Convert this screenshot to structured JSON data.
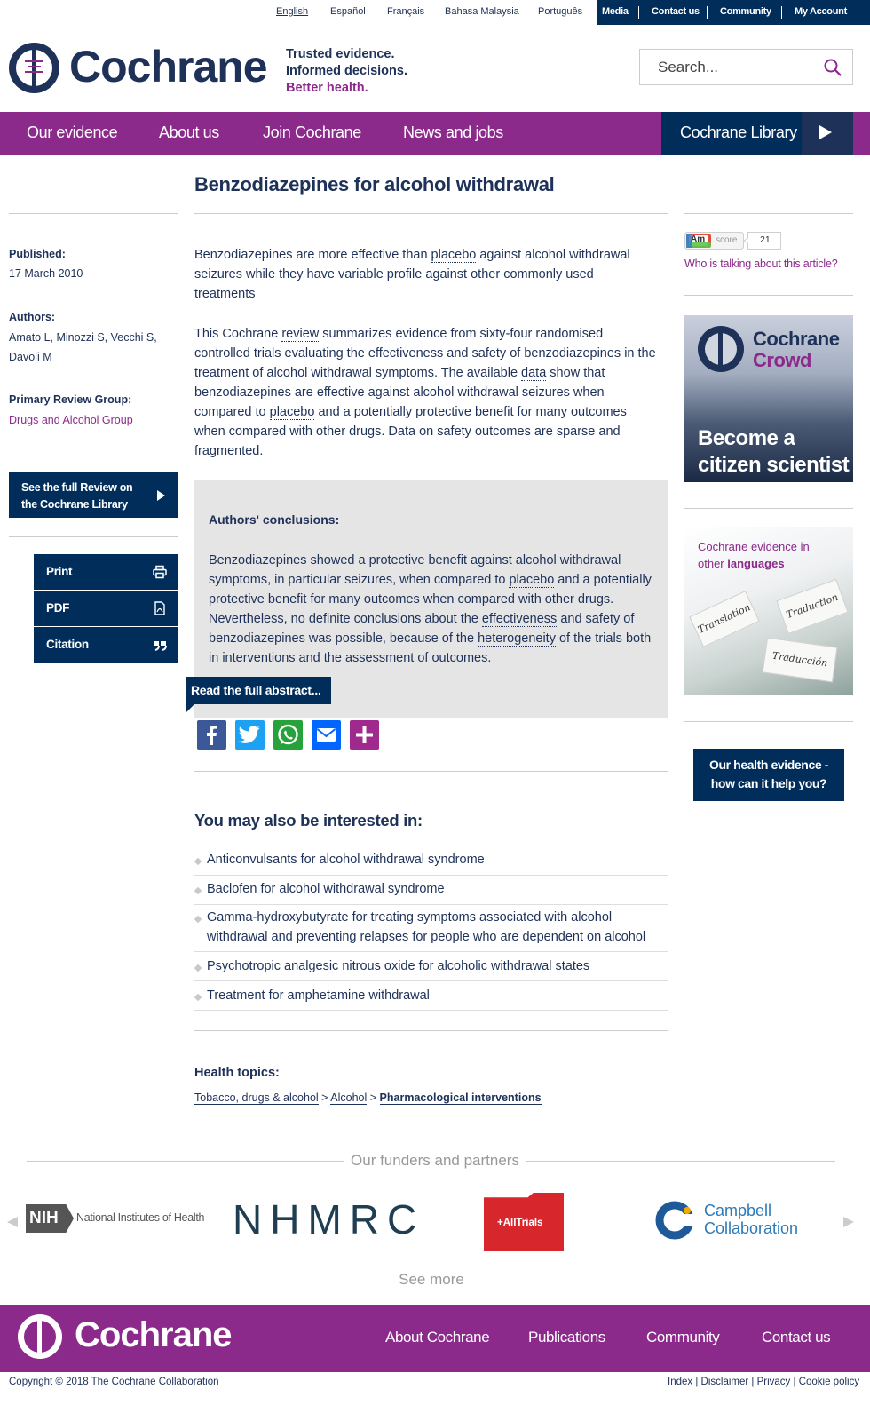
{
  "top_links": {
    "languages": [
      "English",
      "Español",
      "Français",
      "Bahasa Malaysia",
      "Português"
    ],
    "utility": [
      "Media",
      "Contact us",
      "Community",
      "My Account"
    ]
  },
  "header": {
    "wordmark": "Cochrane",
    "tagline": [
      "Trusted evidence.",
      "Informed decisions.",
      "Better health."
    ],
    "search_placeholder": "Search..."
  },
  "nav": {
    "items": [
      "Our evidence",
      "About us",
      "Join Cochrane",
      "News and jobs"
    ],
    "library": "Cochrane Library"
  },
  "article": {
    "title": "Benzodiazepines for alcohol withdrawal",
    "published_label": "Published:",
    "published_date": "17 March 2010",
    "authors_label": "Authors:",
    "authors_line1": "Amato L, Minozzi S, Vecchi S,",
    "authors_line2": "Davoli M",
    "group_label": "Primary Review Group:",
    "group": "Drugs and Alcohol Group",
    "full_review_line1": "See the full Review on",
    "full_review_line2": "the Cochrane Library",
    "tools": [
      "Print",
      "PDF",
      "Citation"
    ],
    "p1": {
      "a": "Benzodiazepines are more effective than ",
      "link1": "placebo",
      "b": " against alcohol withdrawal seizures while they have ",
      "link2": "variable",
      "c": " profile against other commonly used treatments"
    },
    "p2": {
      "a": "This Cochrane ",
      "link1": "review",
      "b": " summarizes evidence from sixty-four randomised controlled trials evaluating the ",
      "link2": "effectiveness",
      "c": " and safety of benzodiazepines in the treatment of alcohol withdrawal symptoms. The available ",
      "link3": "data",
      "d": " show that benzodiazepines are effective against alcohol withdrawal seizures when compared to ",
      "link4": "placebo",
      "e": " and a potentially protective benefit for many outcomes when compared with other drugs. Data on safety outcomes are sparse and fragmented."
    },
    "conclusions_heading": "Authors' conclusions:",
    "conclusions": {
      "a": "Benzodiazepines showed a protective benefit against alcohol withdrawal symptoms, in particular seizures, when compared to ",
      "link1": "placebo",
      "b": " and a potentially protective benefit for many outcomes when compared with other drugs. Nevertheless, no definite conclusions about the ",
      "link2": "effectiveness",
      "c": " and safety of benzodiazepines was possible, because of the ",
      "link3": "heterogeneity",
      "d": " of the trials both in interventions and the assessment of outcomes."
    },
    "read_more": "Read the full abstract..."
  },
  "related": {
    "heading": "You may also be interested in:",
    "items": [
      "Anticonvulsants for alcohol withdrawal syndrome",
      "Baclofen for alcohol withdrawal syndrome",
      "Gamma-hydroxybutyrate for treating symptoms associated with alcohol withdrawal and preventing relapses for people who are dependent on alcohol",
      "Psychotropic analgesic nitrous oxide for alcoholic withdrawal states",
      "Treatment for amphetamine withdrawal"
    ]
  },
  "health_topics": {
    "heading": "Health topics:",
    "crumbs": [
      "Tobacco, drugs & alcohol",
      "Alcohol",
      "Pharmacological interventions"
    ],
    "sep": ">"
  },
  "sidebar": {
    "altmetric_badge": "Am",
    "altmetric_score_label": "score",
    "altmetric_score": "21",
    "altmetric_link": "Who is talking about this article?",
    "crowd_line1": "Cochrane",
    "crowd_line2": "Crowd",
    "crowd_cta1": "Become a",
    "crowd_cta2": "citizen scientist",
    "lang_line1": "Cochrane evidence in",
    "lang_line2a": "other ",
    "lang_line2b": "languages",
    "puzzle_words": [
      "Translation",
      "Traduction",
      "Traducción"
    ],
    "health_cta1": "Our health evidence -",
    "health_cta2": "how can it help you?"
  },
  "funders": {
    "heading": "Our funders and partners",
    "nih_badge": "NIH",
    "nih_name": "National Institutes of Health",
    "nhmrc": "NHMRC",
    "alltrials": "+AllTrials",
    "campbell1": "Campbell",
    "campbell2": "Collaboration",
    "see_more": "See more"
  },
  "footer": {
    "wordmark": "Cochrane",
    "links": [
      "About Cochrane",
      "Publications",
      "Community",
      "Contact us"
    ],
    "copyright": "Copyright © 2018 The Cochrane Collaboration",
    "legal": [
      "Index",
      "Disclaimer",
      "Privacy",
      "Cookie policy"
    ]
  },
  "colors": {
    "navy": "#1e3158",
    "dark_navy": "#002d5a",
    "purple": "#8b2a8b"
  }
}
